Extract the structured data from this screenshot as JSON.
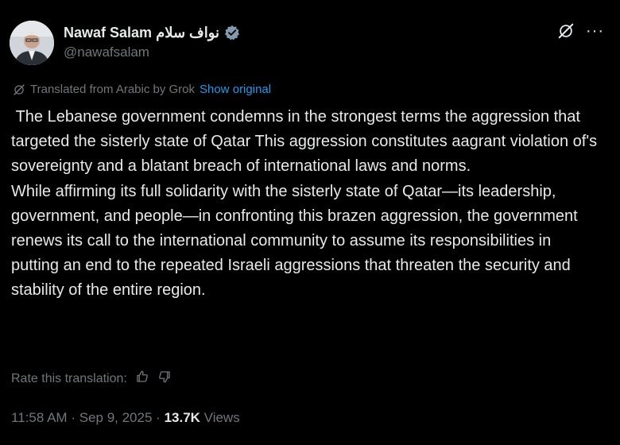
{
  "author": {
    "name": "Nawaf Salam نواف سلام",
    "handle": "@nawafsalam",
    "verified_icon": "verified-badge-icon",
    "verified_color": "#829aab"
  },
  "top_actions": {
    "grok_icon": "grok-icon",
    "more_label": "···"
  },
  "translation": {
    "label": "Translated from Arabic by Grok",
    "show_original": "Show original"
  },
  "tweet": {
    "paragraph1": " The Lebanese government condemns in the strongest terms the aggression that targeted the sisterly state of Qatar This aggression constitutes aagrant violation of's sovereignty and a blatant breach of international laws and norms.",
    "paragraph2": "While affirming its full solidarity with the sisterly state of Qatar—its leadership, government, and people—in confronting this brazen aggression, the government renews its call to the international community to assume its responsibilities in putting an end to the repeated Israeli aggressions that threaten the security and stability of the entire region."
  },
  "rate": {
    "label": "Rate this translation:",
    "thumbs_up_icon": "thumbs-up-icon",
    "thumbs_down_icon": "thumbs-down-icon"
  },
  "meta": {
    "time": "11:58 AM",
    "separator": "·",
    "date": "Sep 9, 2025",
    "views_count": "13.7K",
    "views_label": "Views"
  },
  "colors": {
    "background": "#000000",
    "text": "#e7e9ea",
    "secondary": "#71767b",
    "link": "#1d9bf0"
  }
}
